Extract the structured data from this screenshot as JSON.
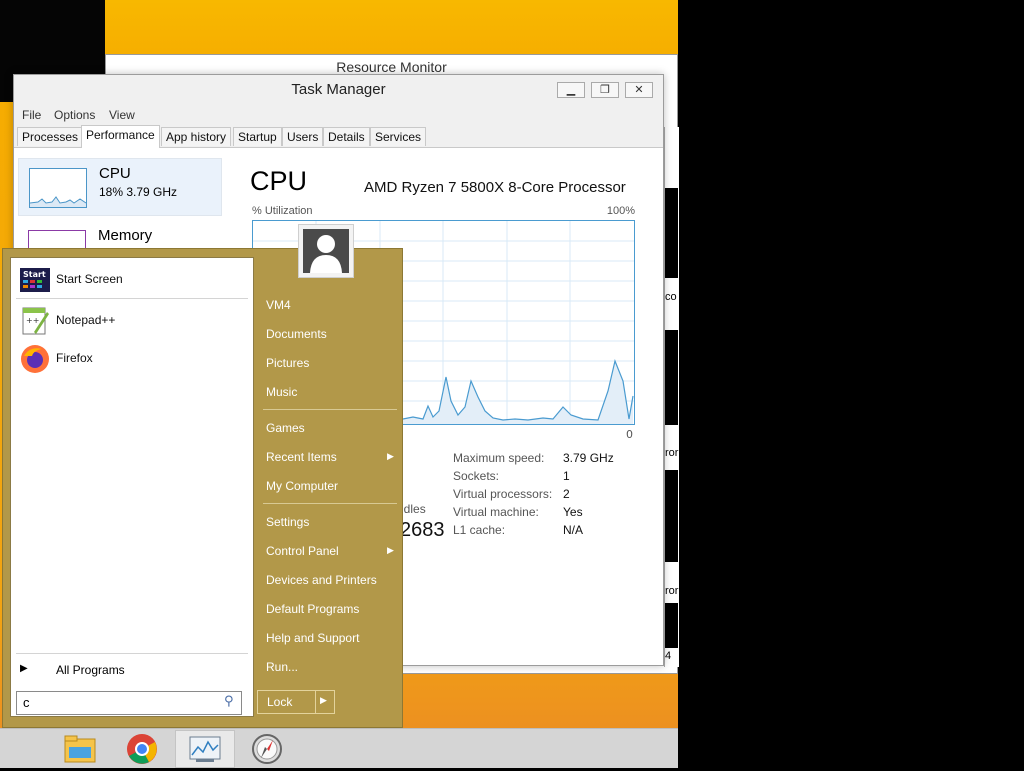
{
  "resource_monitor": {
    "title": "Resource Monitor",
    "side_texts": [
      "co",
      "ror",
      "ror",
      "4"
    ]
  },
  "task_manager": {
    "title": "Task Manager",
    "window_buttons": [
      "minimize",
      "maximize",
      "close"
    ],
    "menu": [
      "File",
      "Options",
      "View"
    ],
    "tabs": [
      "Processes",
      "Performance",
      "App history",
      "Startup",
      "Users",
      "Details",
      "Services"
    ],
    "active_tab": "Performance",
    "sidebar": [
      {
        "name": "CPU",
        "detail": "18%  3.79 GHz"
      },
      {
        "name": "Memory"
      }
    ],
    "cpu": {
      "heading": "CPU",
      "model": "AMD Ryzen 7 5800X 8-Core Processor",
      "util_label": "% Utilization",
      "util_max": "100%",
      "graph_min": "0",
      "handles_label": "ndles",
      "handles_value": "2683",
      "stats": [
        {
          "label": "Maximum speed:",
          "value": "3.79 GHz"
        },
        {
          "label": "Sockets:",
          "value": "1"
        },
        {
          "label": "Virtual processors:",
          "value": "2"
        },
        {
          "label": "Virtual machine:",
          "value": "Yes"
        },
        {
          "label": "L1 cache:",
          "value": "N/A"
        }
      ]
    }
  },
  "start_menu": {
    "pinned": [
      {
        "label": "Start Screen",
        "icon": "start-screen-icon"
      },
      {
        "label": "Notepad++",
        "icon": "notepadpp-icon"
      },
      {
        "label": "Firefox",
        "icon": "firefox-icon"
      }
    ],
    "all_programs": "All Programs",
    "search_value": "c",
    "right_links": [
      {
        "label": "VM4"
      },
      {
        "label": "Documents"
      },
      {
        "label": "Pictures"
      },
      {
        "label": "Music"
      },
      {
        "label": "Games"
      },
      {
        "label": "Recent Items",
        "submenu": true
      },
      {
        "label": "My Computer"
      },
      {
        "label": "Settings"
      },
      {
        "label": "Control Panel",
        "submenu": true
      },
      {
        "label": "Devices and Printers"
      },
      {
        "label": "Default Programs"
      },
      {
        "label": "Help and Support"
      },
      {
        "label": "Run..."
      }
    ],
    "lock_label": "Lock"
  },
  "taskbar": {
    "items": [
      {
        "icon": "file-explorer-icon"
      },
      {
        "icon": "chrome-icon"
      },
      {
        "icon": "resource-monitor-icon",
        "active": true
      },
      {
        "icon": "compass-icon"
      }
    ]
  },
  "colors": {
    "start_menu_bg": "#b29849",
    "desktop_bg": "#f6ad00",
    "graph_line": "#4a9bd0"
  }
}
